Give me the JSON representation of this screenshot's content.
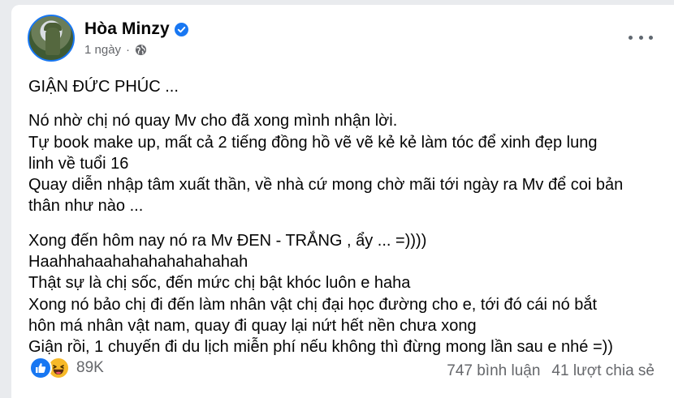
{
  "post": {
    "author": "Hòa Minzy",
    "time": "1 ngày",
    "dot": "·",
    "paragraphs": [
      [
        "GIẬN ĐỨC PHÚC ..."
      ],
      [
        "Nó nhờ chị nó quay Mv cho đã xong mình nhận lời.",
        "Tự book make up, mất cả 2 tiếng đồng hồ vẽ vẽ kẻ kẻ làm tóc để xinh đẹp lung",
        "linh về tuổi 16",
        "Quay diễn nhập tâm xuất thần, về nhà cứ mong chờ mãi tới ngày ra Mv để coi bản",
        "thân như nào ..."
      ],
      [
        "Xong đến hôm nay nó ra Mv ĐEN - TRẮNG , ẩy ... =))))",
        "Haahhahaahahahahahahahah",
        "Thật sự là chị sốc, đến mức chị bật khóc luôn e haha",
        "Xong nó bảo chị đi đến làm nhân vật chị đại học đường cho e, tới đó cái nó bắt",
        "hôn má nhân vật nam, quay đi quay lại nứt hết nền chưa xong",
        "Giận rồi, 1 chuyến đi du lịch miễn phí nếu không thì đừng mong lần sau e nhé =))"
      ]
    ],
    "reaction_count": "89K",
    "comments": "747 bình luận",
    "shares": "41 lượt chia sẻ"
  },
  "icons": {
    "verified": "verified-badge-icon",
    "privacy": "globe-icon",
    "more": "more-options-icon",
    "reactions": [
      "like-icon",
      "haha-icon"
    ]
  },
  "colors": {
    "accent": "#1877f2",
    "text": "#050505",
    "secondary_text": "#65676b",
    "haha": "#f7b928"
  }
}
